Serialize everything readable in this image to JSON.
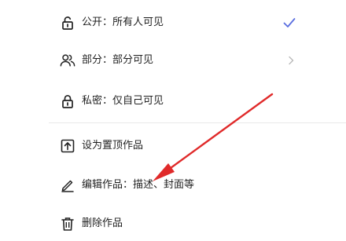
{
  "privacy": {
    "public_label": "公开：所有人可见",
    "partial_label": "部分：部分可见",
    "private_label": "私密：仅自己可见",
    "selected_item": "public",
    "check_icon": "check-icon",
    "chevron_icon": "chevron-right-icon"
  },
  "actions": {
    "pin_label": "设为置顶作品",
    "edit_label": "编辑作品：描述、封面等",
    "delete_label": "删除作品"
  },
  "colors": {
    "accent": "#5a6ee0",
    "arrow": "#e02a2a",
    "text": "#1f1f1f",
    "divider": "#e9e9e9"
  }
}
